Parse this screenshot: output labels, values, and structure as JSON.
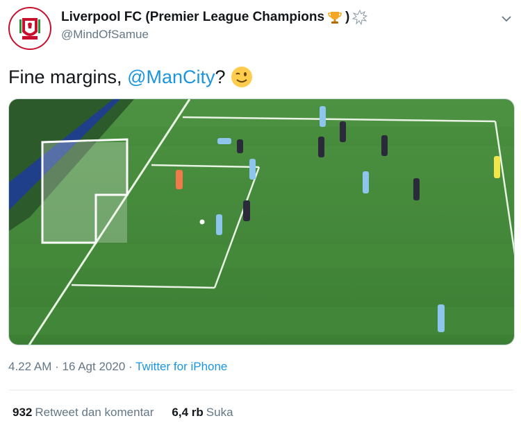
{
  "header": {
    "display_name": "Liverpool FC (Premier League Champions",
    "name_close": ")",
    "handle": "@MindOfSamue",
    "avatar_icon": "liverpool-crest-icon",
    "trophy_icon": "trophy-icon",
    "burst_icon": "anger-burst-icon",
    "menu_icon": "chevron-down-icon"
  },
  "tweet": {
    "text_before": "Fine margins, ",
    "mention": "@ManCity",
    "text_after": "?",
    "emoji_icon": "winking-face-icon"
  },
  "media": {
    "alt": "football-goal-line-scene",
    "icon": "video-frame"
  },
  "meta": {
    "time": "4.22 AM",
    "separator": "·",
    "date": "16 Agt 2020",
    "source": "Twitter for iPhone"
  },
  "stats": {
    "retweets_count": "932",
    "retweets_label": "Retweet dan komentar",
    "likes_count": "6,4 rb",
    "likes_label": "Suka"
  },
  "colors": {
    "link": "#1b95e0",
    "secondary_text": "#657786",
    "pitch_green": "#3f8a3a",
    "lfc_red": "#c8102e"
  }
}
